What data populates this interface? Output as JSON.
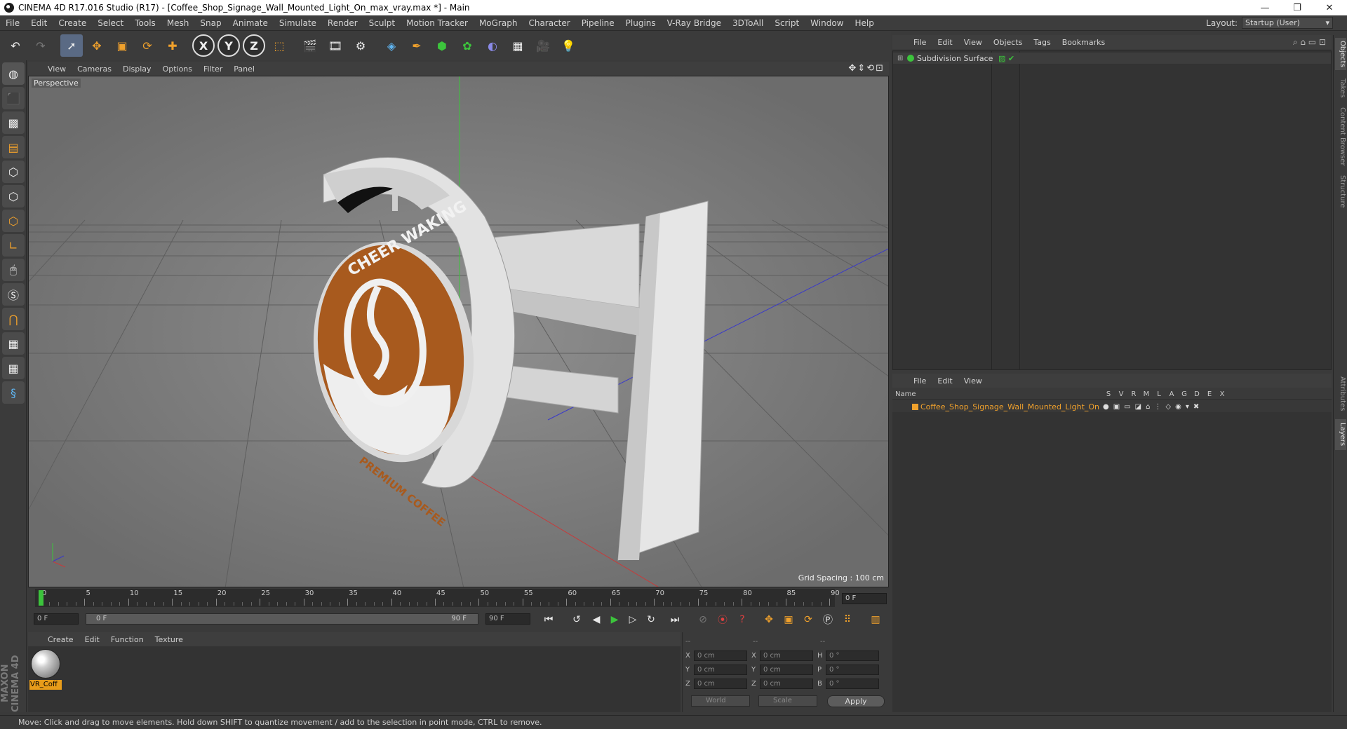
{
  "window": {
    "title": "CINEMA 4D R17.016 Studio (R17) - [Coffee_Shop_Signage_Wall_Mounted_Light_On_max_vray.max *] - Main",
    "controls": [
      "—",
      "❐",
      "✕"
    ]
  },
  "menubar": {
    "items": [
      "File",
      "Edit",
      "Create",
      "Select",
      "Tools",
      "Mesh",
      "Snap",
      "Animate",
      "Simulate",
      "Render",
      "Sculpt",
      "Motion Tracker",
      "MoGraph",
      "Character",
      "Pipeline",
      "Plugins",
      "V-Ray Bridge",
      "3DToAll",
      "Script",
      "Window",
      "Help"
    ],
    "layout_label": "Layout:",
    "layout_value": "Startup (User)"
  },
  "toolbar": {
    "axis_x": "X",
    "axis_y": "Y",
    "axis_z": "Z"
  },
  "viewport": {
    "menu": [
      "View",
      "Cameras",
      "Display",
      "Options",
      "Filter",
      "Panel"
    ],
    "label": "Perspective",
    "grid_spacing": "Grid Spacing : 100 cm",
    "sign_text_top": "CHEER WAKING",
    "sign_text_bottom": "PREMIUM COFFEE"
  },
  "timeline": {
    "ticks": [
      "0",
      "5",
      "10",
      "15",
      "20",
      "25",
      "30",
      "35",
      "40",
      "45",
      "50",
      "55",
      "60",
      "65",
      "70",
      "75",
      "80",
      "85",
      "90"
    ],
    "current_frame": "0 F"
  },
  "playback": {
    "start": "0 F",
    "range_start": "0 F",
    "range_end": "90 F",
    "end": "90 F"
  },
  "material_manager": {
    "menu": [
      "Create",
      "Edit",
      "Function",
      "Texture"
    ],
    "material_name": "VR_Coff"
  },
  "coordinates": {
    "header": [
      "--",
      "--",
      "--"
    ],
    "rows": [
      {
        "l1": "X",
        "v1": "0 cm",
        "l2": "X",
        "v2": "0 cm",
        "l3": "H",
        "v3": "0 °"
      },
      {
        "l1": "Y",
        "v1": "0 cm",
        "l2": "Y",
        "v2": "0 cm",
        "l3": "P",
        "v3": "0 °"
      },
      {
        "l1": "Z",
        "v1": "0 cm",
        "l2": "Z",
        "v2": "0 cm",
        "l3": "B",
        "v3": "0 °"
      }
    ],
    "mode": "World",
    "scale": "Scale",
    "apply": "Apply"
  },
  "object_manager": {
    "menu": [
      "File",
      "Edit",
      "View",
      "Objects",
      "Tags",
      "Bookmarks"
    ],
    "object_name": "Subdivision Surface"
  },
  "layer_manager": {
    "menu": [
      "File",
      "Edit",
      "View"
    ],
    "header_name": "Name",
    "flags": [
      "S",
      "V",
      "R",
      "M",
      "L",
      "A",
      "G",
      "D",
      "E",
      "X"
    ],
    "layer_name": "Coffee_Shop_Signage_Wall_Mounted_Light_On"
  },
  "side_tabs": [
    "Objects",
    "Takes",
    "Content Browser",
    "Structure",
    "Attributes",
    "Layers"
  ],
  "maxon_logo": "MAXON CINEMA 4D",
  "status": "Move: Click and drag to move elements. Hold down SHIFT to quantize movement / add to the selection in point mode, CTRL to remove.",
  "colors": {
    "accent_orange": "#f0a12c",
    "sign_brown": "#a85a1e",
    "axis_green": "#3cc43c"
  }
}
